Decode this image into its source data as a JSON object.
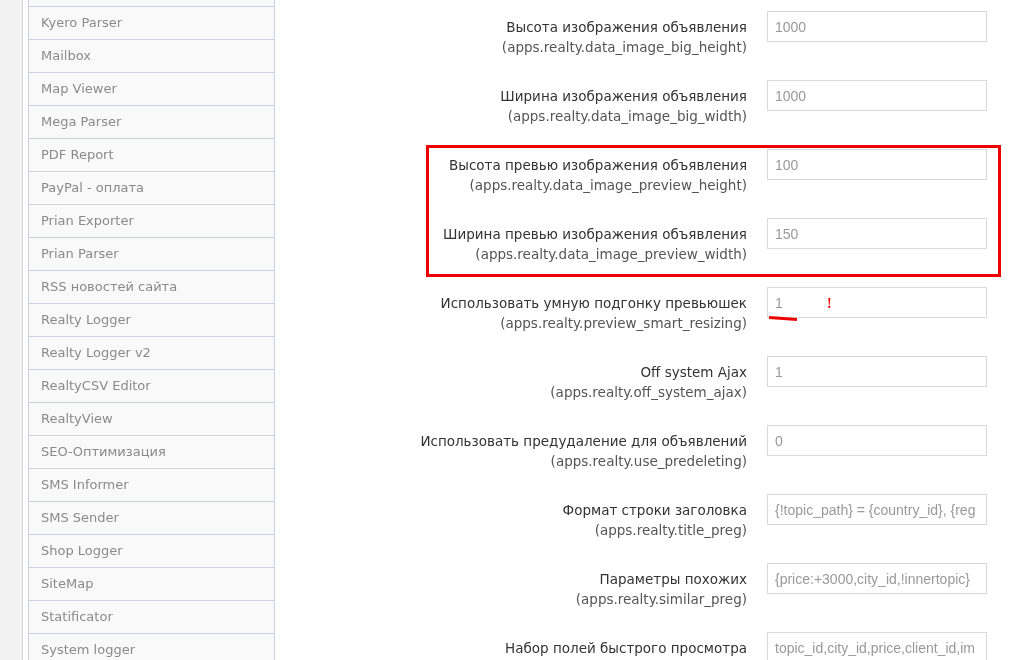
{
  "sidebar": {
    "items": [
      {
        "label": "Kyero Parser"
      },
      {
        "label": "Mailbox"
      },
      {
        "label": "Map Viewer"
      },
      {
        "label": "Mega Parser"
      },
      {
        "label": "PDF Report"
      },
      {
        "label": "PayPal - оплата"
      },
      {
        "label": "Prian Exporter"
      },
      {
        "label": "Prian Parser"
      },
      {
        "label": "RSS новостей сайта"
      },
      {
        "label": "Realty Logger"
      },
      {
        "label": "Realty Logger v2"
      },
      {
        "label": "RealtyCSV Editor"
      },
      {
        "label": "RealtyView"
      },
      {
        "label": "SEO-Оптимизация"
      },
      {
        "label": "SMS Informer"
      },
      {
        "label": "SMS Sender"
      },
      {
        "label": "Shop Logger"
      },
      {
        "label": "SiteMap"
      },
      {
        "label": "Statificator"
      },
      {
        "label": "System logger"
      }
    ]
  },
  "settings": [
    {
      "label": "Высота изображения объявления",
      "key": "(apps.realty.data_image_big_height)",
      "value": "1000",
      "highlighted": false
    },
    {
      "label": "Ширина изображения объявления",
      "key": "(apps.realty.data_image_big_width)",
      "value": "1000",
      "highlighted": false
    },
    {
      "label": "Высота превью изображения объявления",
      "key": "(apps.realty.data_image_preview_height)",
      "value": "100",
      "highlighted": true
    },
    {
      "label": "Ширина превью изображения объявления",
      "key": "(apps.realty.data_image_preview_width)",
      "value": "150",
      "highlighted": true
    },
    {
      "label": "Использовать умную подгонку превьюшек",
      "key": "(apps.realty.preview_smart_resizing)",
      "value": "1",
      "highlighted": false,
      "flag": "!"
    },
    {
      "label": "Off system Ajax",
      "key": "(apps.realty.off_system_ajax)",
      "value": "1",
      "highlighted": false
    },
    {
      "label": "Использовать предудаление для объявлений",
      "key": "(apps.realty.use_predeleting)",
      "value": "0",
      "highlighted": false
    },
    {
      "label": "Формат строки заголовка",
      "key": "(apps.realty.title_preg)",
      "value": "{!topic_path} = {country_id}, {reg",
      "highlighted": false
    },
    {
      "label": "Параметры похожих",
      "key": "(apps.realty.similar_preg)",
      "value": "{price:+3000,city_id,!innertopic}",
      "highlighted": false
    },
    {
      "label": "Набор полей быстрого просмотра",
      "value": "topic_id,city_id,price,client_id,im",
      "highlighted": false
    }
  ]
}
